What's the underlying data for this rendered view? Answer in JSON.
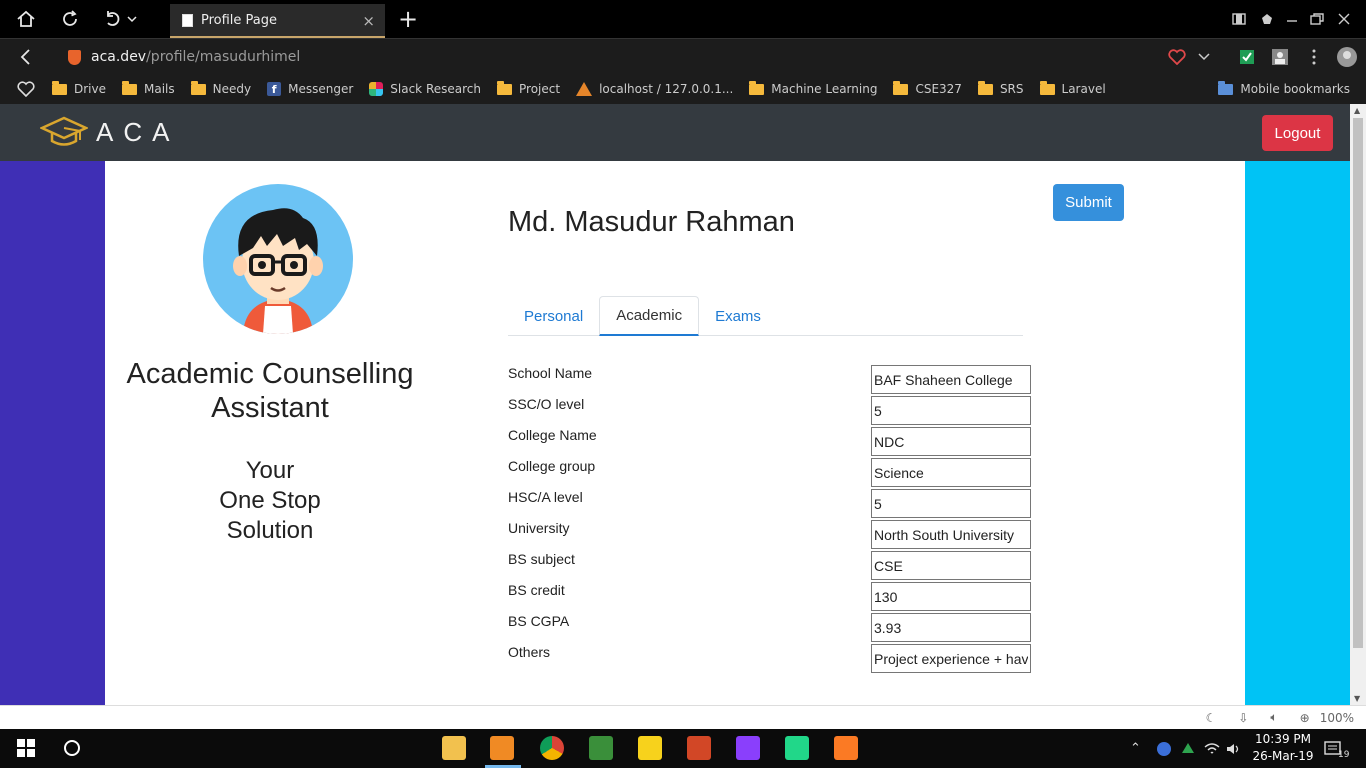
{
  "browser": {
    "tab_title": "Profile Page",
    "tab_close": "×",
    "new_tab": "+",
    "url_host": "aca.dev",
    "url_path": "/profile/masudurhimel",
    "bookmarks": [
      {
        "label": "Drive",
        "icon": "folder-icon"
      },
      {
        "label": "Mails",
        "icon": "folder-icon"
      },
      {
        "label": "Needy",
        "icon": "folder-icon"
      },
      {
        "label": "Messenger",
        "icon": "facebook-icon"
      },
      {
        "label": "Slack Research",
        "icon": "slack-icon"
      },
      {
        "label": "Project",
        "icon": "folder-icon"
      },
      {
        "label": "localhost / 127.0.0.1...",
        "icon": "phpmyadmin-icon"
      },
      {
        "label": "Machine Learning",
        "icon": "folder-icon"
      },
      {
        "label": "CSE327",
        "icon": "folder-icon"
      },
      {
        "label": "SRS",
        "icon": "folder-icon"
      },
      {
        "label": "Laravel",
        "icon": "folder-icon"
      }
    ],
    "mobile_bookmarks": "Mobile bookmarks",
    "zoom": "100%"
  },
  "app": {
    "logo_text": "ACA",
    "logout_label": "Logout",
    "submit_label": "Submit",
    "brand_title": "Academic Counselling Assistant",
    "slogan_line1": "Your",
    "slogan_line2": "One Stop",
    "slogan_line3": "Solution",
    "user_name": "Md. Masudur Rahman",
    "tabs": [
      {
        "label": "Personal",
        "active": false
      },
      {
        "label": "Academic",
        "active": true
      },
      {
        "label": "Exams",
        "active": false
      }
    ],
    "fields": [
      {
        "label": "School Name",
        "value": "BAF Shaheen College"
      },
      {
        "label": "SSC/O level",
        "value": "5"
      },
      {
        "label": "College Name",
        "value": "NDC"
      },
      {
        "label": "College group",
        "value": "Science"
      },
      {
        "label": "HSC/A level",
        "value": "5"
      },
      {
        "label": "University",
        "value": "North South University"
      },
      {
        "label": "BS subject",
        "value": "CSE"
      },
      {
        "label": "BS credit",
        "value": "130"
      },
      {
        "label": "BS CGPA",
        "value": "3.93"
      },
      {
        "label": "Others",
        "value": "Project experience + hav"
      }
    ],
    "colors": {
      "navbar": "#343a40",
      "logout": "#dc3545",
      "submit": "#3590dc",
      "left_band": "#3f2fb5",
      "right_band": "#00c3f5",
      "logo_gold": "#d9a62e"
    }
  },
  "taskbar": {
    "time": "10:39 PM",
    "date": "26-Mar-19",
    "notifications": "19"
  }
}
